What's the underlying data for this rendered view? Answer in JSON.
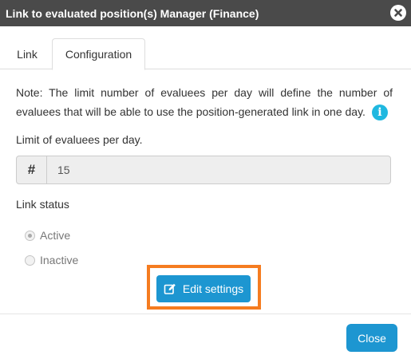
{
  "dialog": {
    "title": "Link to evaluated position(s) Manager (Finance)",
    "close_icon": "close-icon"
  },
  "tabs": [
    {
      "label": "Link",
      "active": false
    },
    {
      "label": "Configuration",
      "active": true
    }
  ],
  "note": {
    "text": "Note: The limit number of evaluees per day will define the number of evaluees that will be able to use the position-generated link in one day.",
    "info_icon": "i"
  },
  "limit": {
    "label": "Limit of evaluees per day.",
    "addon": "#",
    "value": "15"
  },
  "link_status": {
    "label": "Link status",
    "options": [
      {
        "label": "Active",
        "checked": true
      },
      {
        "label": "Inactive",
        "checked": false
      }
    ]
  },
  "buttons": {
    "edit_settings": "Edit settings",
    "close": "Close"
  },
  "colors": {
    "titlebar": "#4a4a4a",
    "primary_button": "#1d96d1",
    "info_icon": "#1fb8e0",
    "highlight_border": "#f57c20"
  }
}
